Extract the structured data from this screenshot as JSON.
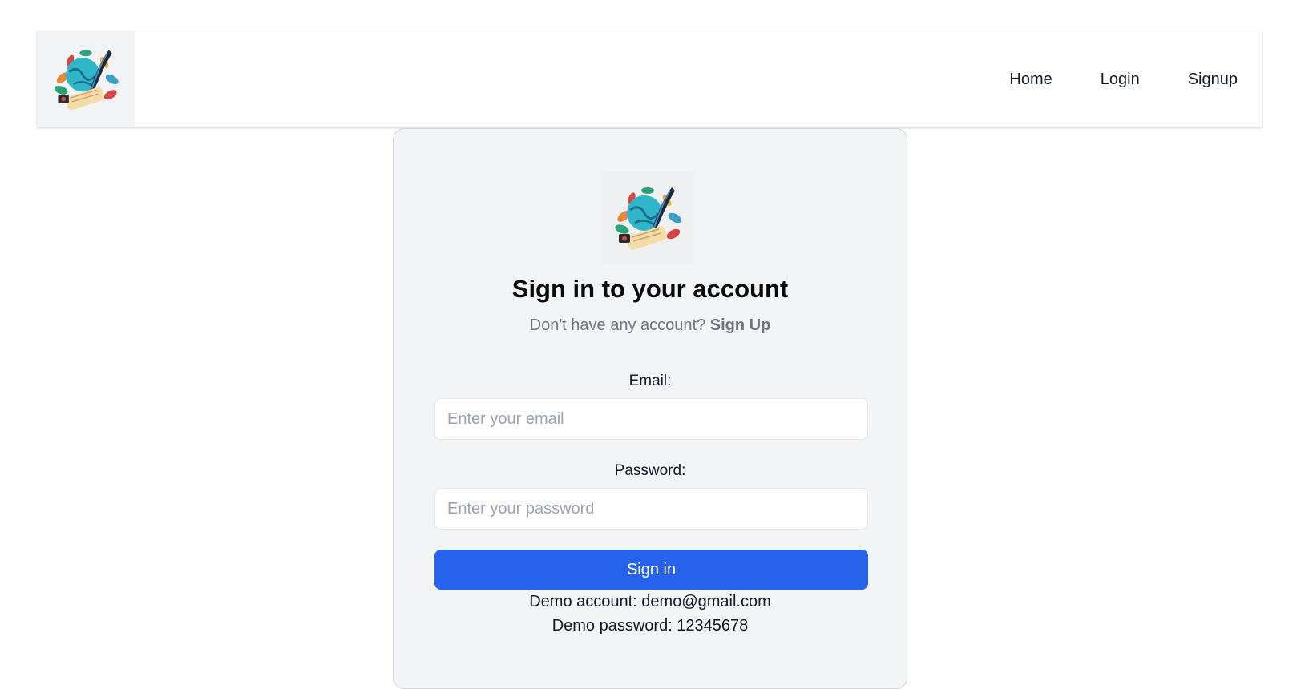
{
  "nav": {
    "logo_icon": "quill-globe-logo-icon",
    "links": [
      "Home",
      "Login",
      "Signup"
    ]
  },
  "card": {
    "logo_icon": "quill-globe-logo-icon",
    "title": "Sign in to your account",
    "subtitle_prefix": "Don't have any account?",
    "subtitle_link": "Sign Up",
    "email_label": "Email:",
    "email_placeholder": "Enter your email",
    "email_value": "",
    "password_label": "Password:",
    "password_placeholder": "Enter your password",
    "password_value": "",
    "submit_label": "Sign in",
    "demo_account": "Demo account: demo@gmail.com",
    "demo_password": "Demo password: 12345678"
  },
  "colors": {
    "accent": "#2563eb",
    "card_bg": "#f3f4f6",
    "muted_text": "#6b7280"
  }
}
